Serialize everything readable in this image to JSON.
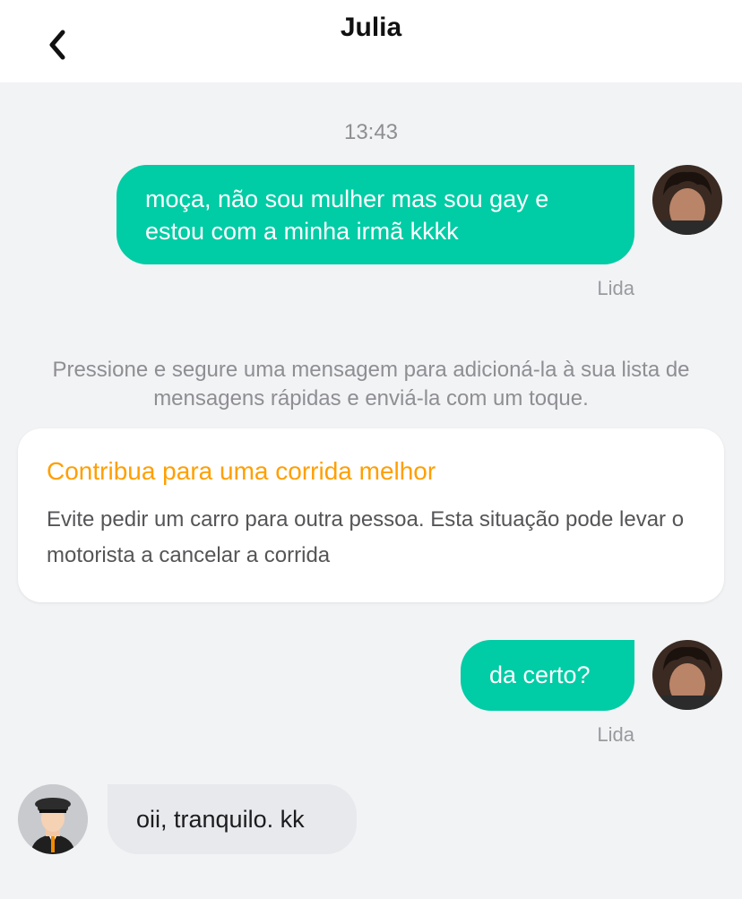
{
  "header": {
    "title": "Julia",
    "back_icon": "chevron-left-icon"
  },
  "chat": {
    "timestamp": "13:43",
    "messages": [
      {
        "direction": "outgoing",
        "text": "moça, não sou mulher mas sou gay e estou com a minha irmã kkkk",
        "status": "Lida"
      },
      {
        "direction": "outgoing",
        "text": "da certo?",
        "status": "Lida"
      },
      {
        "direction": "incoming",
        "text": "oii, tranquilo. kk"
      }
    ],
    "hint": "Pressione e segure uma mensagem para adicioná-la à sua lista de mensagens rápidas e enviá-la com um toque.",
    "tip": {
      "title": "Contribua para uma corrida melhor",
      "body": "Evite pedir um carro para outra pessoa. Esta situação pode levar o motorista a cancelar a corrida"
    }
  },
  "colors": {
    "outgoing_bubble": "#00cca5",
    "incoming_bubble": "#e8e9ec",
    "tip_title": "#ff9f00",
    "background": "#f2f3f5"
  }
}
